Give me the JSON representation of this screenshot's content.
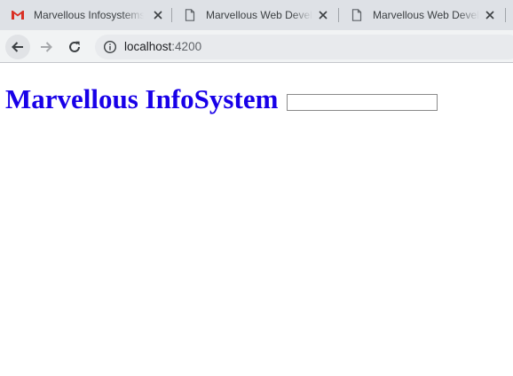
{
  "tabs": [
    {
      "title": "Marvellous Infosystems",
      "favicon": "gmail-icon",
      "active": false
    },
    {
      "title": "Marvellous Web Development",
      "favicon": "document-icon",
      "active": false
    },
    {
      "title": "Marvellous Web Development",
      "favicon": "document-icon",
      "active": false
    }
  ],
  "toolbar": {
    "back": "back-arrow-icon",
    "forward": "forward-arrow-icon",
    "reload": "reload-icon",
    "site_info": "info-icon",
    "url_host": "localhost",
    "url_port": ":4200"
  },
  "page": {
    "heading": "Marvellous InfoSystem",
    "input_value": ""
  },
  "colors": {
    "heading": "#1800e8",
    "tabstrip": "#dee1e6",
    "toolbar": "#f1f3f4",
    "omnibox": "#e8eaed"
  }
}
